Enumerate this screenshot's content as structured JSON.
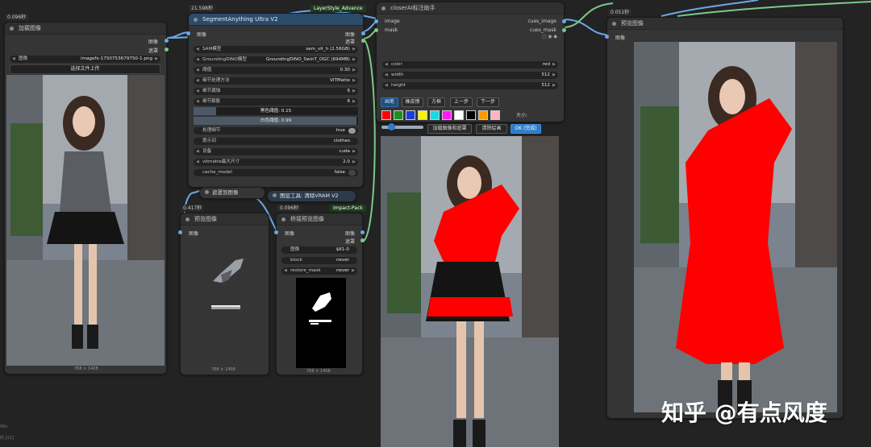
{
  "load_node": {
    "time": "0.096秒",
    "title": "加载图像",
    "out_image": "图像",
    "out_mask": "遮罩",
    "image_label": "图像",
    "image_value": "imagefx-1750753679750-1.png",
    "upload_label": "选择文件上传",
    "size": "768 × 1408"
  },
  "sam_node": {
    "time": "21.598秒",
    "tag": "LayerStyle_Advance",
    "title": "SegmentAnything Ultra V2",
    "in_image": "图像",
    "out_image": "图像",
    "out_mask": "遮罩",
    "widgets": [
      {
        "label": "SAM模型",
        "value": "sam_vit_h (2.56GB)"
      },
      {
        "label": "GroundingDINO模型",
        "value": "GroundingDINO_SwinT_OGC (694MB)"
      },
      {
        "label": "阈值",
        "value": "0.30"
      },
      {
        "label": "细节处理方法",
        "value": "VITMatte"
      },
      {
        "label": "细节腐蚀",
        "value": "6"
      },
      {
        "label": "细节膨胀",
        "value": "6"
      }
    ],
    "black_point": "黑色阈值: 0.15",
    "black_point_value": "0.15",
    "white_point": "白色阈值: 0.99",
    "white_point_value": "0.99",
    "widgets2": [
      {
        "label": "处理细节",
        "value": "true"
      },
      {
        "label": "提示词",
        "value": "clothes"
      },
      {
        "label": "设备",
        "value": "cuda"
      },
      {
        "label": "vitmatte最大尺寸",
        "value": "2.0"
      },
      {
        "label": "cache_model",
        "value": "false"
      }
    ]
  },
  "mask_to_image": {
    "title": "遮罩到图像"
  },
  "vram_node": {
    "title": "图层工具: 清除VRAM V2"
  },
  "preview1": {
    "time": "0.417秒",
    "title": "预览图像",
    "in_image": "图像",
    "size": "768 × 1408"
  },
  "bridge_node": {
    "time": "0.096秒",
    "tag": "Impact-Pack",
    "title": "桥接预览图像",
    "in_image": "图像",
    "out_image": "图像",
    "out_mask": "遮罩",
    "widgets": [
      {
        "label": "图像",
        "value": "$61-0"
      },
      {
        "label": "block",
        "value": "never"
      },
      {
        "label": "restore_mask",
        "value": "never"
      }
    ],
    "size": "768 × 1408"
  },
  "closer_node": {
    "title": "closerAI标注助手",
    "in_image": "image",
    "in_mask": "mask",
    "out_image": "cues_image",
    "out_mask": "cues_mask",
    "widgets": [
      {
        "label": "color",
        "value": "red"
      },
      {
        "label": "width",
        "value": "512"
      },
      {
        "label": "height",
        "value": "512"
      }
    ],
    "tools": [
      "画笔",
      "橡皮擦",
      "方框",
      "上一步",
      "下一步"
    ],
    "size_label": "大小:",
    "actions": [
      "加载图像和遮罩",
      "清除绘画",
      "OK (完成)"
    ],
    "swatches": [
      "#ff0000",
      "#1e8f1e",
      "#1a3fd6",
      "#f5f500",
      "#19d9e6",
      "#ff19ff",
      "#ffffff",
      "#000000",
      "#ff9900",
      "#ffb3c6"
    ]
  },
  "preview2": {
    "time": "0.051秒",
    "title": "预览图像",
    "in_image": "图像"
  },
  "watermark": "知乎 @有点风度",
  "footer": [
    "00s",
    "的 [11]"
  ]
}
